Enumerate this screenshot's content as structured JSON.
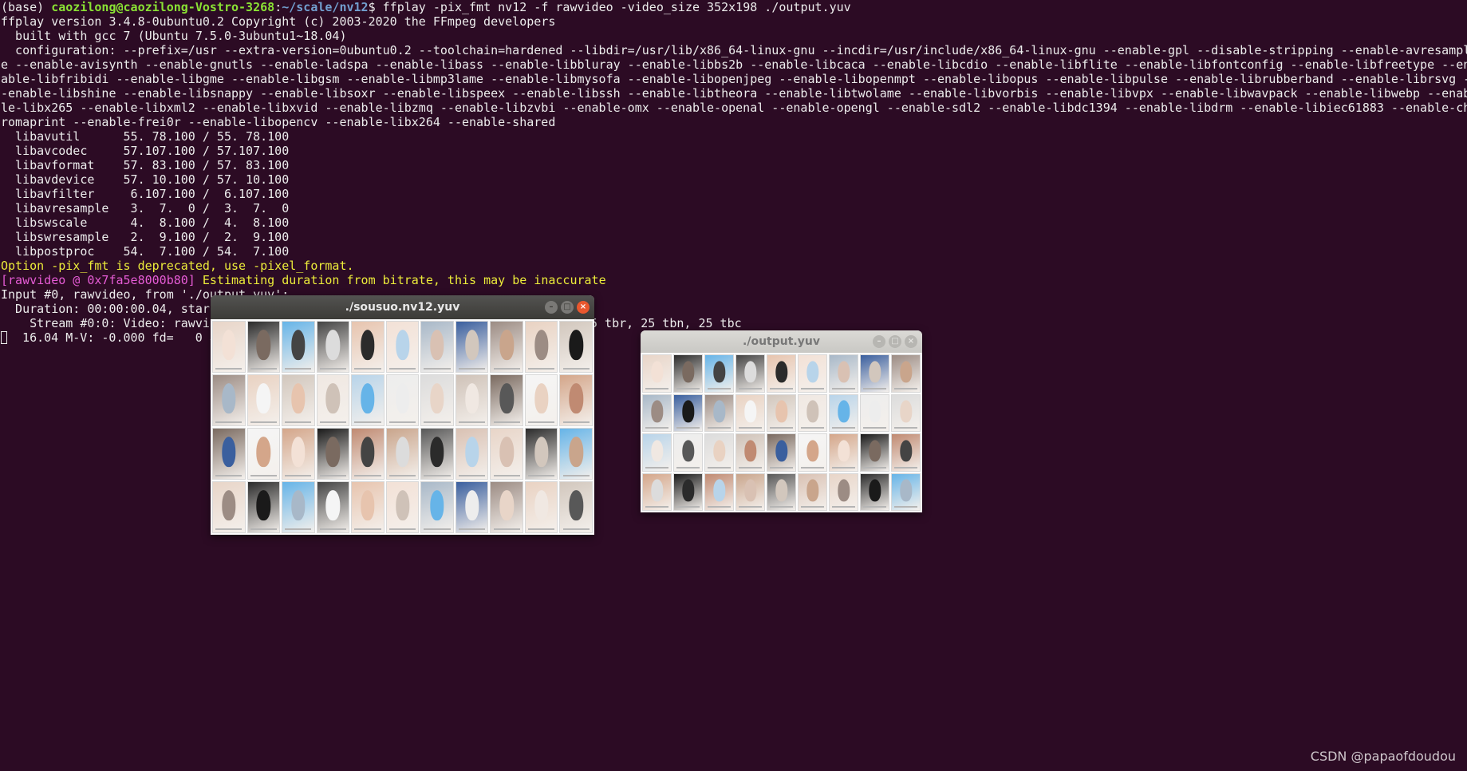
{
  "terminal": {
    "prompt_env": "(base) ",
    "prompt_user_host": "caozilong@caozilong-Vostro-3268",
    "prompt_colon": ":",
    "prompt_path": "~/scale/nv12",
    "prompt_command": "$ ffplay -pix_fmt nv12 -f rawvideo -video_size 352x198 ./output.yuv",
    "lines": [
      "ffplay version 3.4.8-0ubuntu0.2 Copyright (c) 2003-2020 the FFmpeg developers",
      "  built with gcc 7 (Ubuntu 7.5.0-3ubuntu1~18.04)",
      "  configuration: --prefix=/usr --extra-version=0ubuntu0.2 --toolchain=hardened --libdir=/usr/lib/x86_64-linux-gnu --incdir=/usr/include/x86_64-linux-gnu --enable-gpl --disable-stripping --enable-avresampl",
      "e --enable-avisynth --enable-gnutls --enable-ladspa --enable-libass --enable-libbluray --enable-libbs2b --enable-libcaca --enable-libcdio --enable-libflite --enable-libfontconfig --enable-libfreetype --en",
      "able-libfribidi --enable-libgme --enable-libgsm --enable-libmp3lame --enable-libmysofa --enable-libopenjpeg --enable-libopenmpt --enable-libopus --enable-libpulse --enable-librubberband --enable-librsvg -",
      "-enable-libshine --enable-libsnappy --enable-libsoxr --enable-libspeex --enable-libssh --enable-libtheora --enable-libtwolame --enable-libvorbis --enable-libvpx --enable-libwavpack --enable-libwebp --enab",
      "le-libx265 --enable-libxml2 --enable-libxvid --enable-libzmq --enable-libzvbi --enable-omx --enable-openal --enable-opengl --enable-sdl2 --enable-libdc1394 --enable-libdrm --enable-libiec61883 --enable-ch",
      "romaprint --enable-frei0r --enable-libopencv --enable-libx264 --enable-shared",
      "  libavutil      55. 78.100 / 55. 78.100",
      "  libavcodec     57.107.100 / 57.107.100",
      "  libavformat    57. 83.100 / 57. 83.100",
      "  libavdevice    57. 10.100 / 57. 10.100",
      "  libavfilter     6.107.100 /  6.107.100",
      "  libavresample   3.  7.  0 /  3.  7.  0",
      "  libswscale      4.  8.100 /  4.  8.100",
      "  libswresample   2.  9.100 /  2.  9.100",
      "  libpostproc    54.  7.100 / 54.  7.100"
    ],
    "deprecation_warning": "Option -pix_fmt is deprecated, use -pixel_format.",
    "rawvideo_tag": "[rawvideo @ 0x7fa5e8000b80]",
    "rawvideo_message": " Estimating duration from bitrate, this may be inaccurate",
    "input_line": "Input #0, rawvideo, from './output.yuv':",
    "duration_line": "  Duration: 00:00:00.04, star",
    "stream_line": "    Stream #0:0: Video: rawvic",
    "stream_tail": "5 tbr, 25 tbn, 25 tbc",
    "status_line": "  16.04 M-V: -0.000 fd=   0 ac"
  },
  "windows": {
    "sousuo": {
      "title": "./sousuo.nv12.yuv",
      "minimize_glyph": "–",
      "maximize_glyph": "□",
      "close_glyph": "×"
    },
    "output": {
      "title": "./output.yuv",
      "minimize_glyph": "–",
      "maximize_glyph": "□",
      "close_glyph": "×"
    }
  },
  "thumbnail_tones": [
    "#e8d5c8",
    "#3a5f9e",
    "#dcdcdc",
    "#c9a58c",
    "#e7c4ae",
    "#f0e8e2",
    "#d4a68a",
    "#2b2b2b",
    "#9c8c84",
    "#cfc2b8",
    "#585858",
    "#f3e1d6",
    "#b8d4ea",
    "#1a1a1a",
    "#66b4e8",
    "#e9d2c2",
    "#7a6a60",
    "#d9c1b3",
    "#a8b8c8",
    "#ededed",
    "#c08a72",
    "#444444",
    "#d2c7bd",
    "#f5f5f5"
  ],
  "watermark": "CSDN @papaofdoudou"
}
